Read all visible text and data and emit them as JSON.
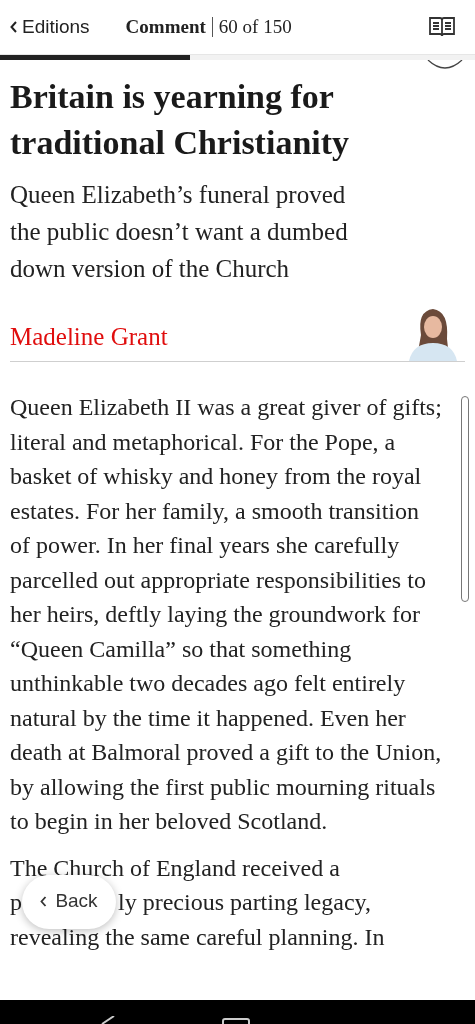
{
  "header": {
    "back_label": "Editions",
    "section": "Comment",
    "position": "60 of 150"
  },
  "progress": {
    "level": 0.4
  },
  "article": {
    "headline": "Britain is yearning for traditional Christianity",
    "standfirst": "Queen Elizabeth’s funeral proved the public doesn’t want a dumbed down version of the Church",
    "author": "Madeline Grant",
    "paragraph_1": "Queen Elizabeth II was a great giver of gifts; literal and metaphorical. For the Pope, a basket of whisky and honey from the royal estates. For her family, a smooth transition of power. In her final years she carefully parcelled out appropriate responsibilities to her heirs, deftly laying the groundwork for “Queen Camilla” so that something unthinkable two decades ago felt entirely natural by the time it happened. Even her death at Balmoral proved a gift to the Union, by allowing the first public mourning rituals to begin in her beloved Scotland.",
    "paragraph_2_lines": [
      [
        "The Church of England received a"
      ],
      [
        "p",
        "ly precious parting legacy,"
      ],
      [
        "revealing the same careful planning. In"
      ]
    ]
  },
  "back_button": {
    "label": "Back"
  }
}
